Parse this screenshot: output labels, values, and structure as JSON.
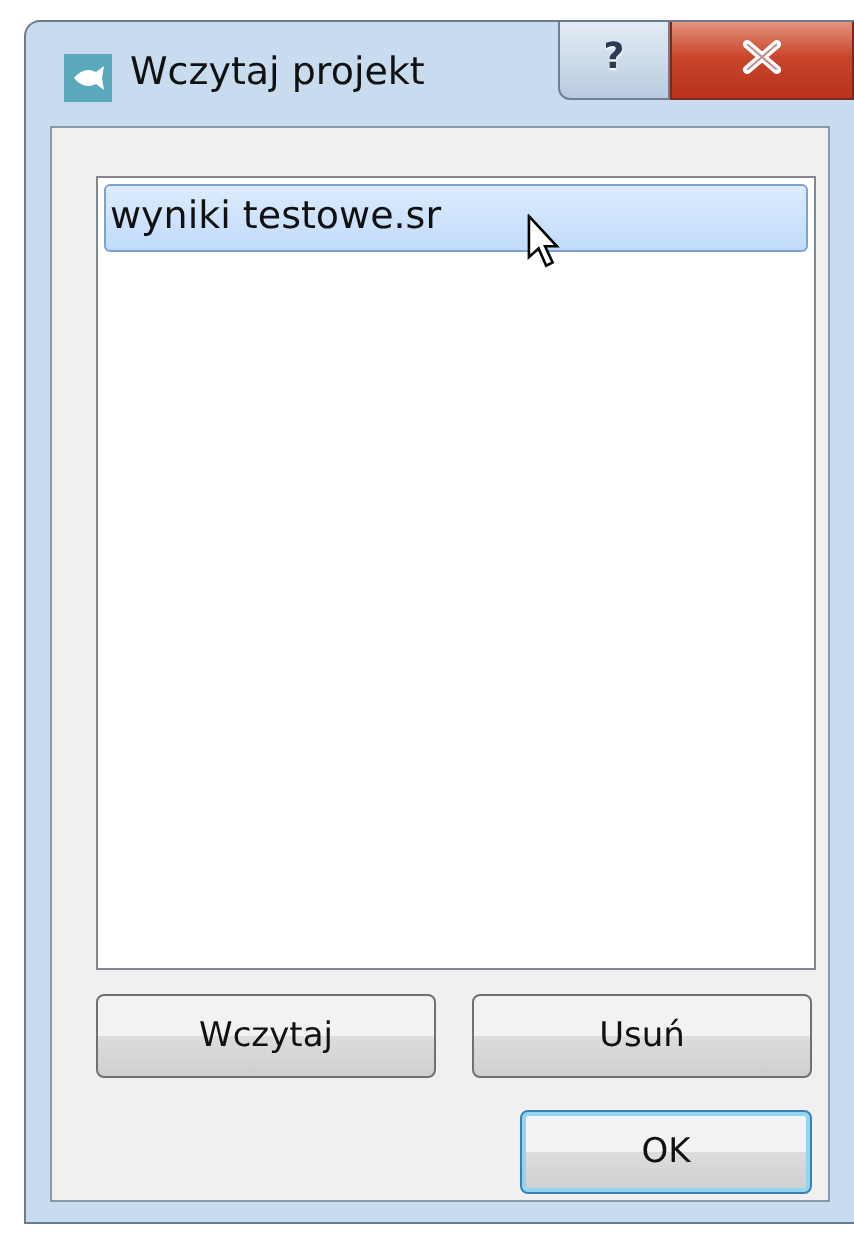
{
  "window": {
    "title": "Wczytaj projekt",
    "help_button": "?"
  },
  "list": {
    "items": [
      {
        "label": "wyniki testowe.sr",
        "selected": true
      }
    ]
  },
  "action_buttons": [
    {
      "label": "Wczytaj",
      "default": false
    },
    {
      "label": "Usuń",
      "default": false
    }
  ],
  "dialog_buttons": [
    {
      "label": "OK",
      "default": true
    }
  ]
}
